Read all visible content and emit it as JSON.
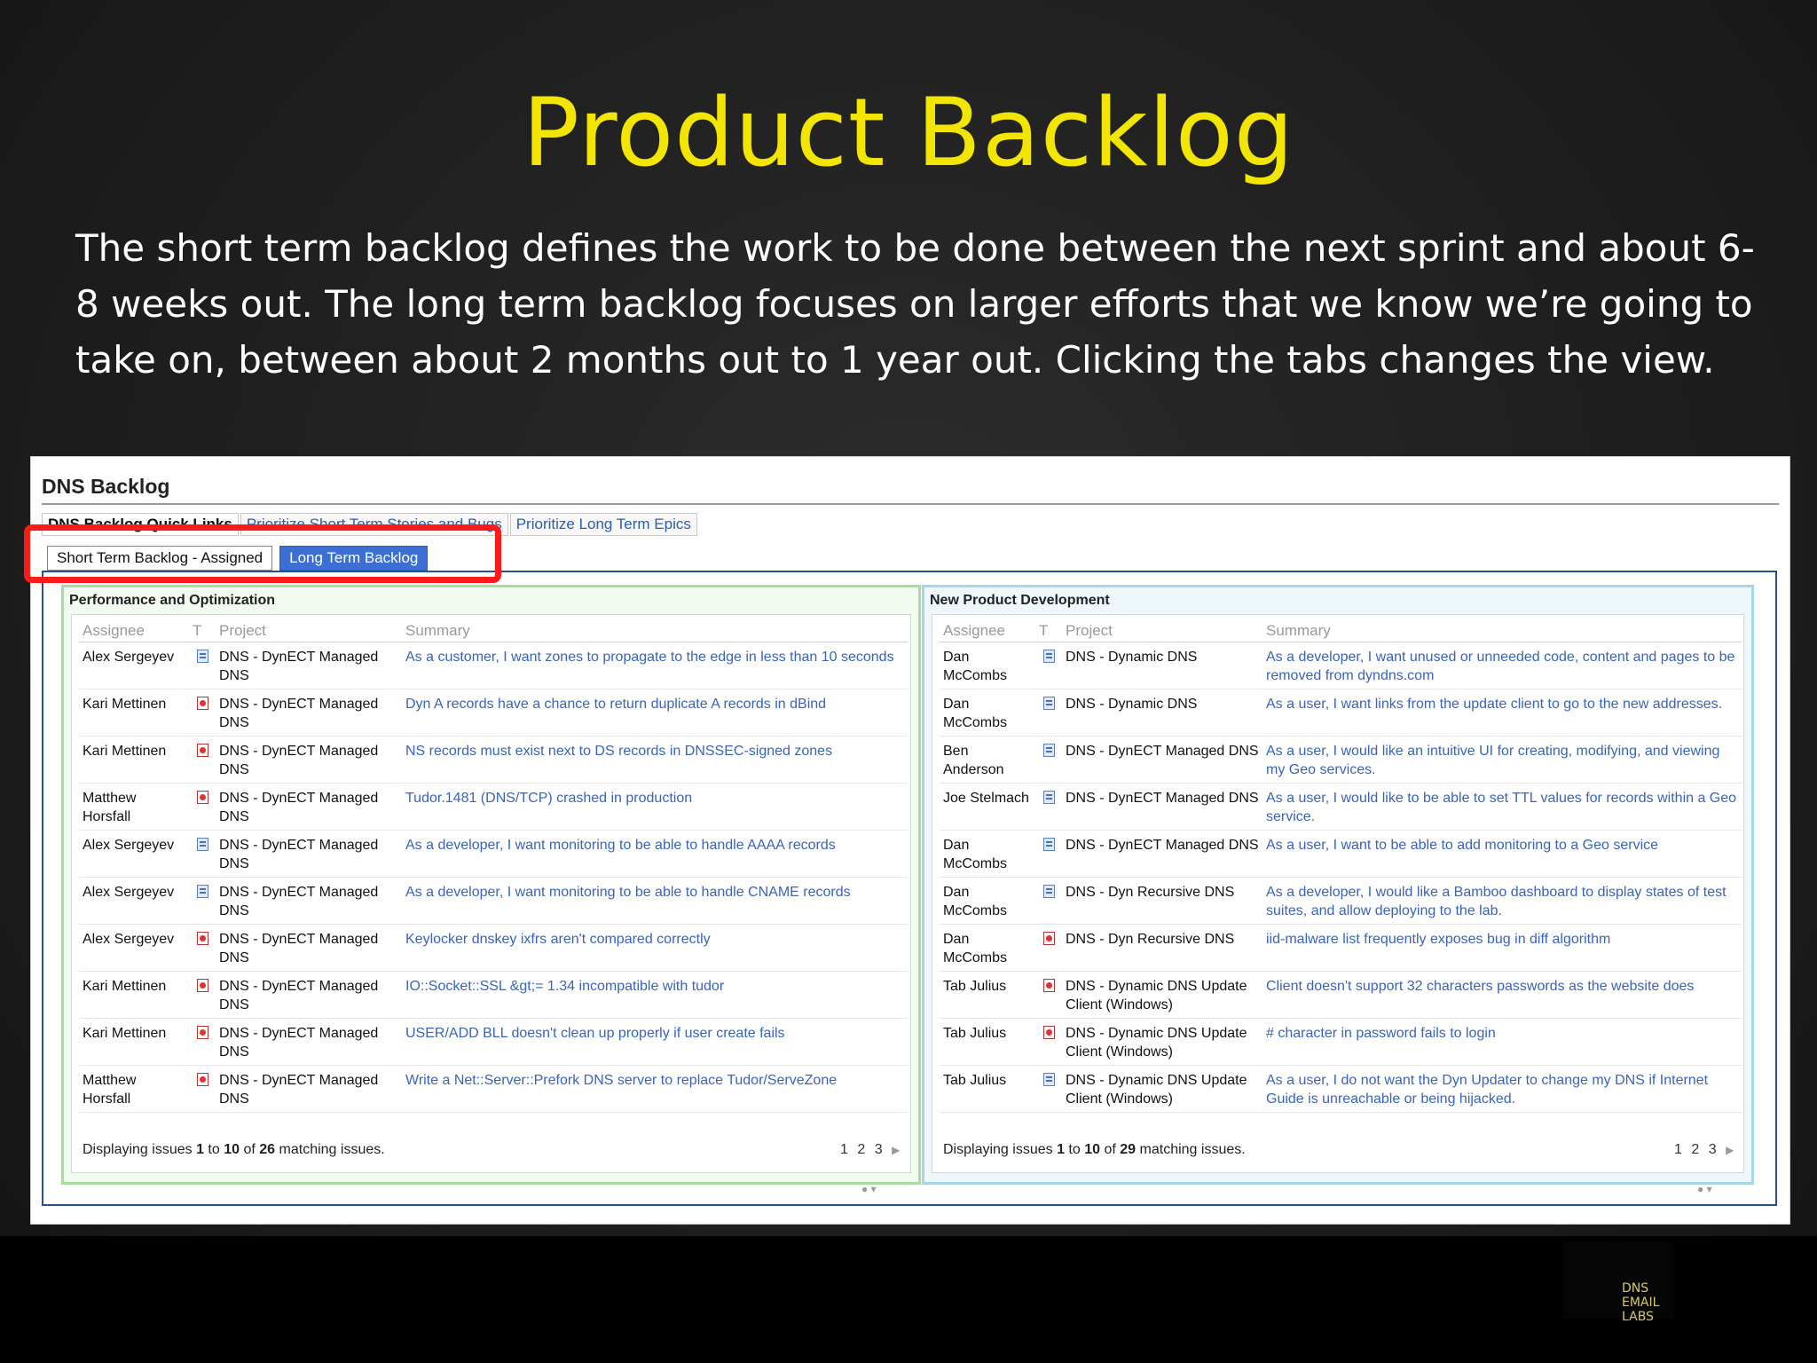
{
  "slide": {
    "title": "Product Backlog",
    "body": "The short term backlog defines the work to be done between the next sprint and about 6-8 weeks out. The long term backlog focuses on larger efforts that we know we’re going to take on, between about 2 months out to 1 year out. Clicking the tabs changes the view.",
    "logo_lines": [
      "DNS",
      "EMAIL",
      "LABS"
    ]
  },
  "app": {
    "title": "DNS Backlog",
    "top_tabs": [
      "DNS Backlog Quick Links",
      "Prioritize Short Term Stories and Bugs",
      "Prioritize Long Term Epics"
    ],
    "view_tabs": [
      "Short Term Backlog - Assigned",
      "Long Term Backlog"
    ],
    "selected_view_tab": "Long Term Backlog"
  },
  "columns": [
    "Assignee",
    "T",
    "Project",
    "Summary"
  ],
  "left_panel": {
    "title": "Performance and Optimization",
    "rows": [
      {
        "assignee": "Alex Sergeyev",
        "type": "story",
        "project": "DNS - DynECT Managed DNS",
        "summary": "As a customer, I want zones to propagate to the edge in less than 10 seconds"
      },
      {
        "assignee": "Kari Mettinen",
        "type": "bug",
        "project": "DNS - DynECT Managed DNS",
        "summary": "Dyn A records have a chance to return duplicate A records in dBind"
      },
      {
        "assignee": "Kari Mettinen",
        "type": "bug",
        "project": "DNS - DynECT Managed DNS",
        "summary": "NS records must exist next to DS records in DNSSEC-signed zones"
      },
      {
        "assignee": "Matthew Horsfall",
        "type": "bug",
        "project": "DNS - DynECT Managed DNS",
        "summary": "Tudor.1481 (DNS/TCP) crashed in production"
      },
      {
        "assignee": "Alex Sergeyev",
        "type": "story",
        "project": "DNS - DynECT Managed DNS",
        "summary": "As a developer, I want monitoring to be able to handle AAAA records"
      },
      {
        "assignee": "Alex Sergeyev",
        "type": "story",
        "project": "DNS - DynECT Managed DNS",
        "summary": "As a developer, I want monitoring to be able to handle CNAME records"
      },
      {
        "assignee": "Alex Sergeyev",
        "type": "bug",
        "project": "DNS - DynECT Managed DNS",
        "summary": "Keylocker dnskey ixfrs aren't compared correctly"
      },
      {
        "assignee": "Kari Mettinen",
        "type": "bug",
        "project": "DNS - DynECT Managed DNS",
        "summary": "IO::Socket::SSL &gt;= 1.34 incompatible with tudor"
      },
      {
        "assignee": "Kari Mettinen",
        "type": "bug",
        "project": "DNS - DynECT Managed DNS",
        "summary": "USER/ADD BLL doesn't clean up properly if user create fails"
      },
      {
        "assignee": "Matthew Horsfall",
        "type": "bug",
        "project": "DNS - DynECT Managed DNS",
        "summary": "Write a Net::Server::Prefork DNS server to replace Tudor/ServeZone"
      }
    ],
    "status": {
      "prefix": "Displaying issues",
      "from": "1",
      "to_word": "to",
      "to": "10",
      "of_word": "of",
      "total": "26",
      "suffix": "matching issues."
    },
    "pages": [
      "1",
      "2",
      "3"
    ]
  },
  "right_panel": {
    "title": "New Product Development",
    "rows": [
      {
        "assignee": "Dan McCombs",
        "type": "story",
        "project": "DNS - Dynamic DNS",
        "summary": "As a developer, I want unused or unneeded code, content and pages to be removed from dyndns.com"
      },
      {
        "assignee": "Dan McCombs",
        "type": "story",
        "project": "DNS - Dynamic DNS",
        "summary": "As a user, I want links from the update client to go to the new addresses."
      },
      {
        "assignee": "Ben Anderson",
        "type": "story",
        "project": "DNS - DynECT Managed DNS",
        "summary": "As a user, I would like an intuitive UI for creating, modifying, and viewing my Geo services."
      },
      {
        "assignee": "Joe Stelmach",
        "type": "story",
        "project": "DNS - DynECT Managed DNS",
        "summary": "As a user, I would like to be able to set TTL values for records within a Geo service."
      },
      {
        "assignee": "Dan McCombs",
        "type": "story",
        "project": "DNS - DynECT Managed DNS",
        "summary": "As a user, I want to be able to add monitoring to a Geo service"
      },
      {
        "assignee": "Dan McCombs",
        "type": "story",
        "project": "DNS - Dyn Recursive DNS",
        "summary": "As a developer, I would like a Bamboo dashboard to display states of test suites, and allow deploying to the lab."
      },
      {
        "assignee": "Dan McCombs",
        "type": "bug",
        "project": "DNS - Dyn Recursive DNS",
        "summary": "iid-malware list frequently exposes bug in diff algorithm"
      },
      {
        "assignee": "Tab Julius",
        "type": "bug",
        "project": "DNS - Dynamic DNS Update Client (Windows)",
        "summary": "Client doesn't support 32 characters passwords as the website does"
      },
      {
        "assignee": "Tab Julius",
        "type": "bug",
        "project": "DNS - Dynamic DNS Update Client (Windows)",
        "summary": "# character in password fails to login"
      },
      {
        "assignee": "Tab Julius",
        "type": "story",
        "project": "DNS - Dynamic DNS Update Client (Windows)",
        "summary": "As a user, I do not want the Dyn Updater to change my DNS if Internet Guide is unreachable or being hijacked."
      }
    ],
    "status": {
      "prefix": "Displaying issues",
      "from": "1",
      "to_word": "to",
      "to": "10",
      "of_word": "of",
      "total": "29",
      "suffix": "matching issues."
    },
    "pages": [
      "1",
      "2",
      "3"
    ]
  }
}
